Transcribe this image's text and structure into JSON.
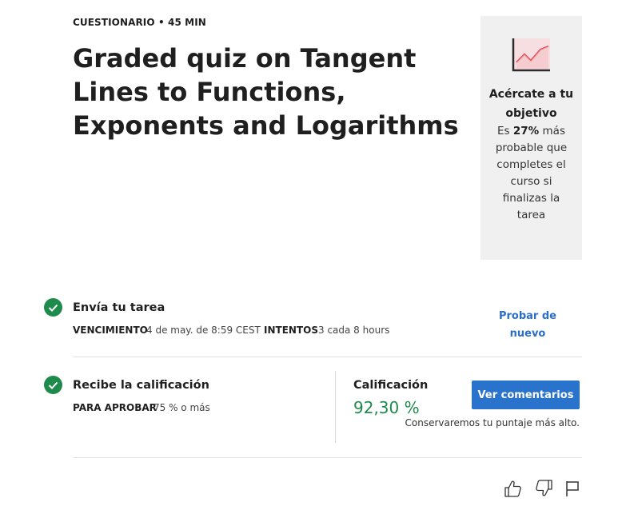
{
  "header": {
    "meta": "CUESTIONARIO • 45 MIN",
    "title": "Graded quiz on Tangent Lines to Functions, Exponents and Logarithms"
  },
  "goal_card": {
    "icon": "trend-chart-icon",
    "title": "Acércate a tu objetivo",
    "text_prefix": "Es",
    "percent": "27%",
    "text_suffix": "más probable que completes el curso si finalizas la tarea"
  },
  "submit_step": {
    "icon": "check-icon",
    "title": "Envía tu tarea",
    "due_label": "VENCIMIENTO",
    "due_value": "4 de may. de 8:59 CEST",
    "attempts_label": "INTENTOS",
    "attempts_value": "3 cada 8 hours",
    "retry_label": "Probar de nuevo"
  },
  "grade_step": {
    "icon": "check-icon",
    "title": "Recibe la calificación",
    "pass_label": "PARA APROBAR",
    "pass_value": "75 % o más",
    "grade_label": "Calificación",
    "grade_value": "92,30 %",
    "feedback_button": "Ver comentarios",
    "keep_note": "Conservaremos tu puntaje más alto."
  },
  "footer_actions": {
    "like_icon": "thumbs-up-icon",
    "dislike_icon": "thumbs-down-icon",
    "flag_icon": "flag-icon"
  },
  "colors": {
    "success": "#1e8a4c",
    "link": "#2a6fc9",
    "primary": "#2a73cc",
    "chart_accent": "#e3414b"
  }
}
